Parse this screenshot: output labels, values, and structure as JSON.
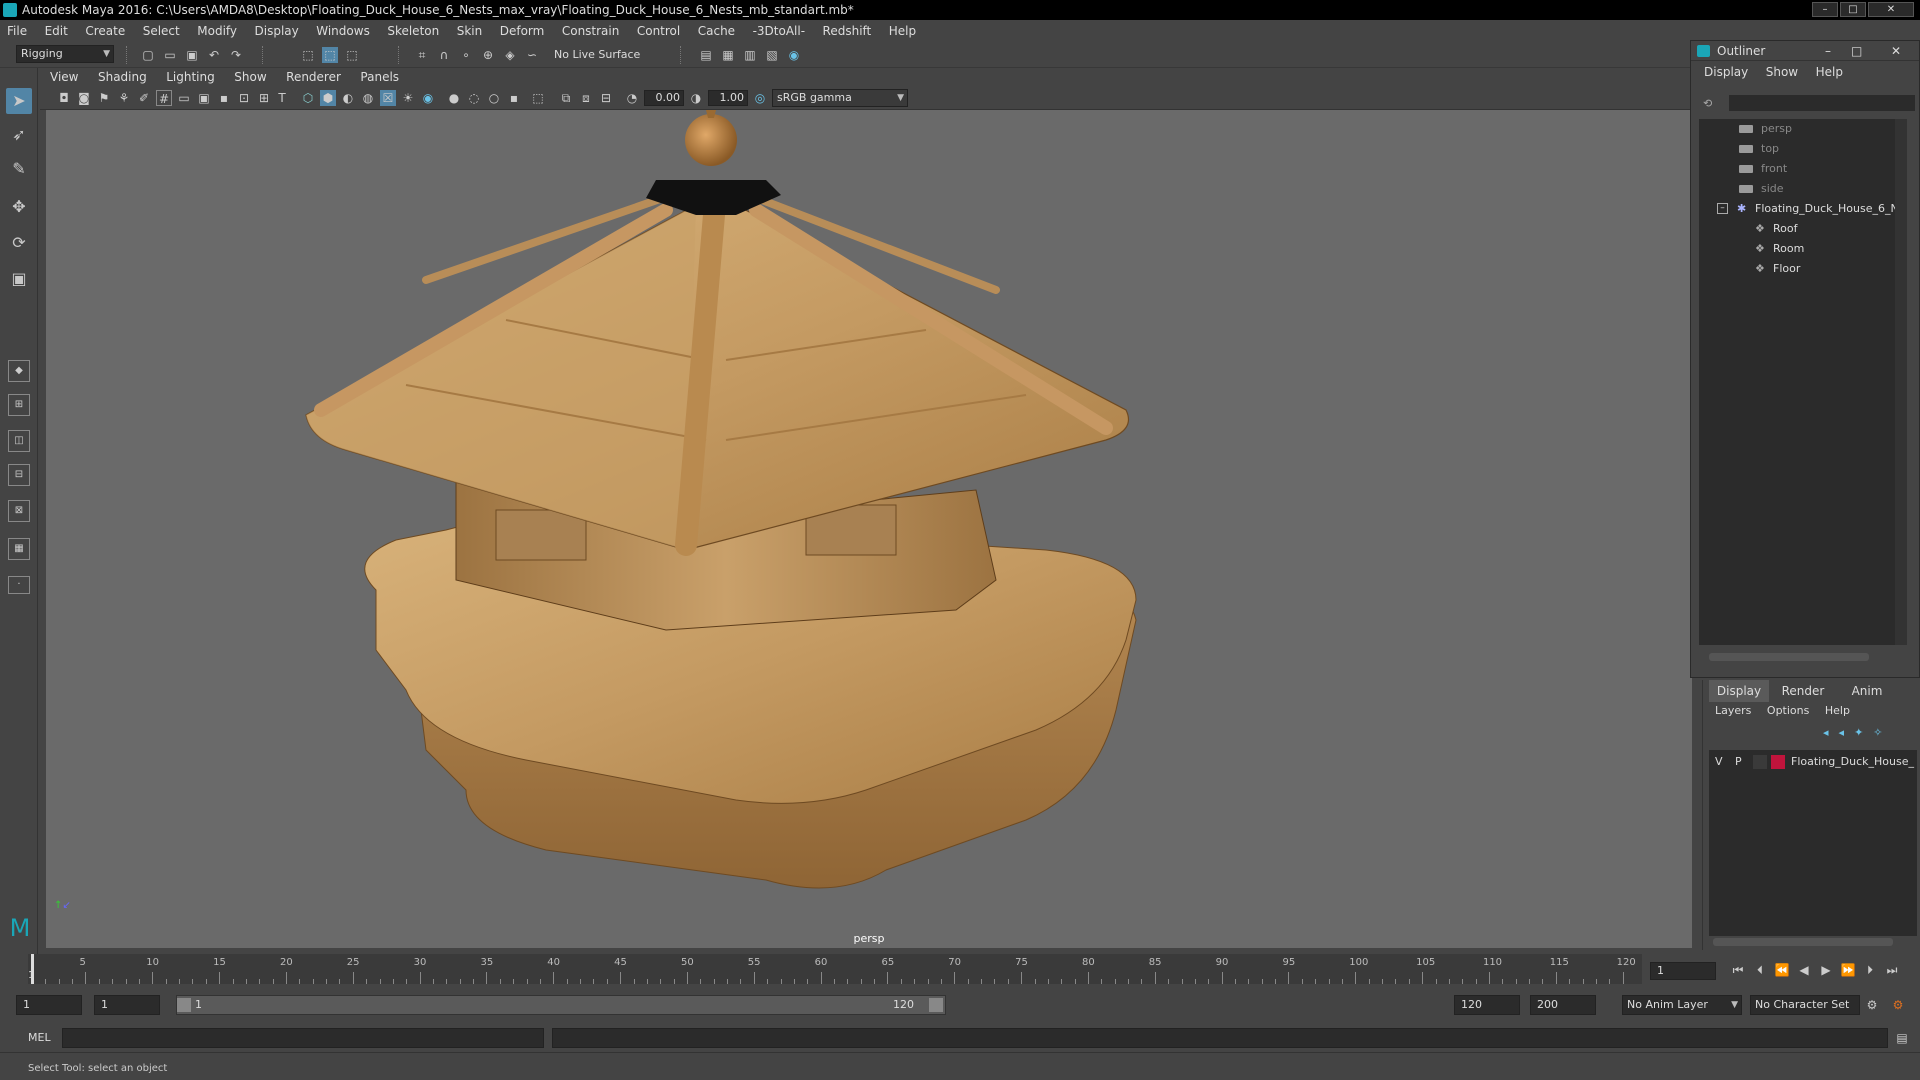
{
  "window": {
    "title": "Autodesk Maya 2016: C:\\Users\\AMDA8\\Desktop\\Floating_Duck_House_6_Nests_max_vray\\Floating_Duck_House_6_Nests_mb_standart.mb*"
  },
  "menubar": [
    "File",
    "Edit",
    "Create",
    "Select",
    "Modify",
    "Display",
    "Windows",
    "Skeleton",
    "Skin",
    "Deform",
    "Constrain",
    "Control",
    "Cache",
    "-3DtoAll-",
    "Redshift",
    "Help"
  ],
  "statusline": {
    "menuset": "Rigging",
    "live_surface": "No Live Surface"
  },
  "panel": {
    "menus": [
      "View",
      "Shading",
      "Lighting",
      "Show",
      "Renderer",
      "Panels"
    ],
    "exposure": "0.00",
    "gamma": "1.00",
    "colorspace": "sRGB gamma",
    "camera": "persp"
  },
  "outliner": {
    "title": "Outliner",
    "menus": [
      "Display",
      "Show",
      "Help"
    ],
    "cameras": [
      "persp",
      "top",
      "front",
      "side"
    ],
    "group": "Floating_Duck_House_6_N",
    "children": [
      "Roof",
      "Room",
      "Floor"
    ]
  },
  "layer_editor": {
    "tabs": [
      "Display",
      "Render",
      "Anim"
    ],
    "menus": [
      "Layers",
      "Options",
      "Help"
    ],
    "layer": {
      "v": "V",
      "p": "P",
      "name": "Floating_Duck_House_",
      "color": "#c0143c"
    }
  },
  "timeline": {
    "ticks": [
      "5",
      "10",
      "15",
      "20",
      "25",
      "30",
      "35",
      "40",
      "45",
      "50",
      "55",
      "60",
      "65",
      "70",
      "75",
      "80",
      "85",
      "90",
      "95",
      "100",
      "105",
      "110",
      "115",
      "120"
    ],
    "current_marker": "1",
    "current_frame": "1"
  },
  "range": {
    "start": "1",
    "playback_start": "1",
    "slider_start": "1",
    "slider_end": "120",
    "playback_end": "120",
    "end": "200",
    "anim_layer": "No Anim Layer",
    "character_set": "No Character Set"
  },
  "command": {
    "lang": "MEL"
  },
  "helpline": {
    "text": "Select Tool: select an object"
  },
  "colors": {
    "accent": "#5285a6",
    "maya_teal": "#1aa6b7",
    "wood": "#c49a62"
  }
}
